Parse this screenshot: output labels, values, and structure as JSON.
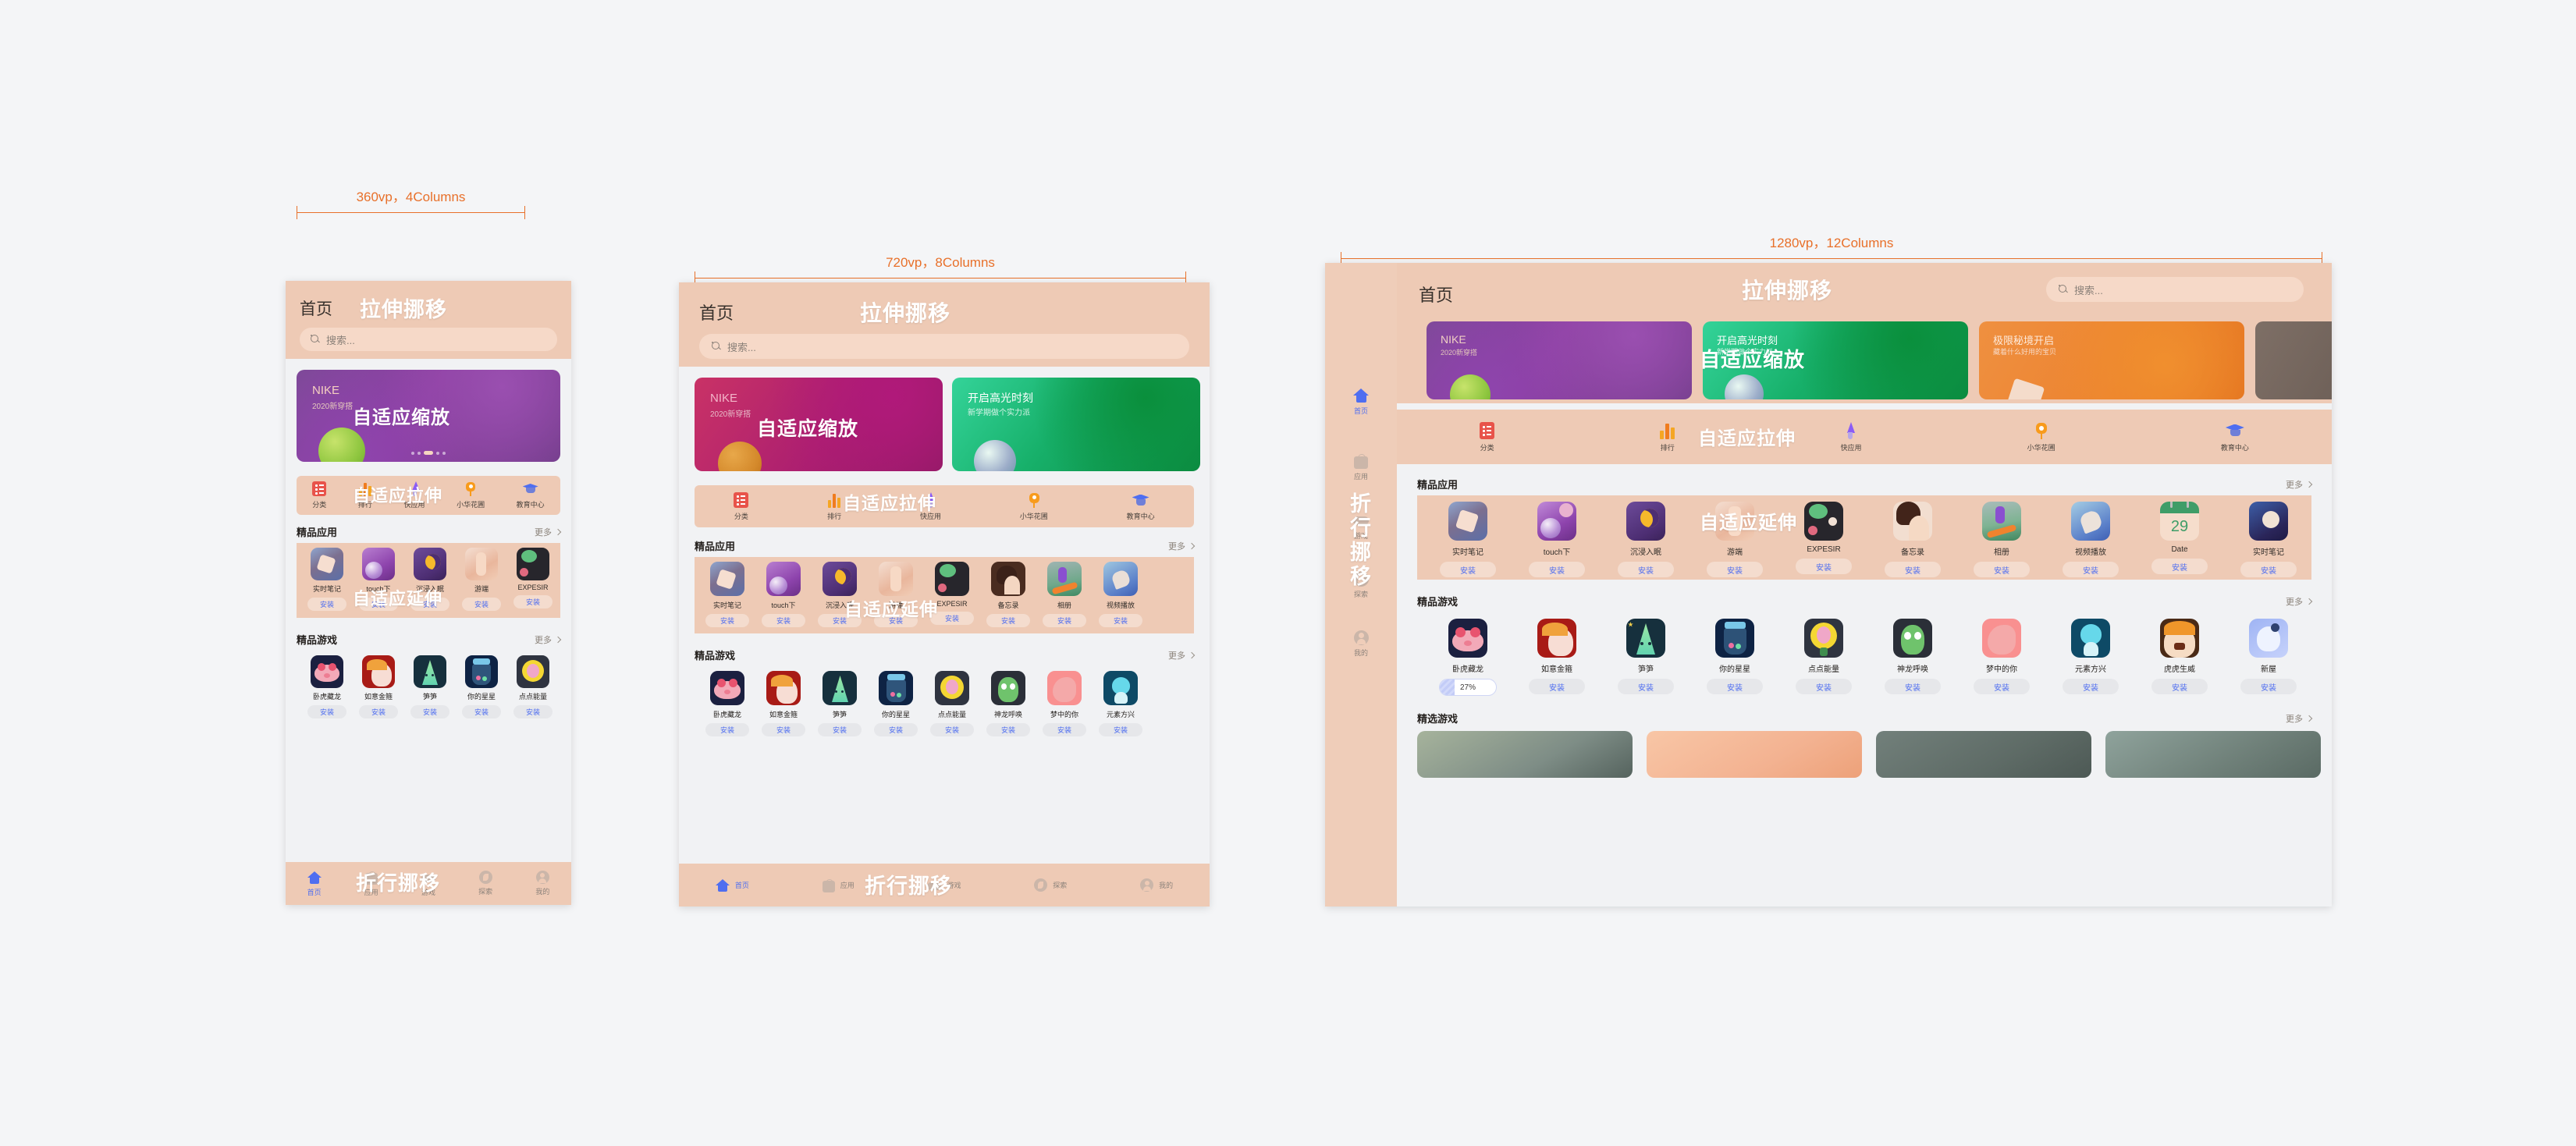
{
  "rulers": [
    {
      "label": "360vp，4Columns"
    },
    {
      "label": "720vp，8Columns"
    },
    {
      "label": "1280vp，12Columns"
    }
  ],
  "overlays": {
    "header": "拉伸挪移",
    "banner": "自适应缩放",
    "quickrow": "自适应拉伸",
    "approw": "自适应延伸",
    "tabbar": "折行挪移"
  },
  "app": {
    "header_title": "首页",
    "search_placeholder": "搜索...",
    "banners": [
      {
        "title": "NIKE",
        "subtitle": "2020新穿搭",
        "theme": "purple"
      },
      {
        "title": "开启高光时刻",
        "subtitle": "新学期做个实力派",
        "theme": "green"
      },
      {
        "title": "极限秘境开启",
        "subtitle": "藏着什么好用的宝贝",
        "theme": "orange"
      },
      {
        "title": "",
        "subtitle": "",
        "theme": "grey"
      }
    ],
    "banners_small": [
      {
        "title": "NIKE",
        "subtitle": "2020新穿搭",
        "theme": "magenta"
      },
      {
        "title": "开启高光时刻",
        "subtitle": "新学期做个实力派",
        "theme": "green"
      },
      {
        "title": "",
        "subtitle": "",
        "theme": "orange"
      }
    ],
    "quick_links": [
      {
        "label": "分类",
        "icon": "list-card-icon"
      },
      {
        "label": "排行",
        "icon": "bar-chart-icon"
      },
      {
        "label": "快应用",
        "icon": "rocket-icon"
      },
      {
        "label": "小华花圃",
        "icon": "flower-icon"
      },
      {
        "label": "教育中心",
        "icon": "graduation-cap-icon"
      }
    ],
    "sections": {
      "apps_title": "精品应用",
      "games_title": "精品游戏",
      "featured_games_title": "精选游戏",
      "more_label": "更多"
    },
    "install_label": "安装",
    "apps": [
      {
        "name": "实时笔记",
        "action": "安装"
      },
      {
        "name": "touch下",
        "action": "安装"
      },
      {
        "name": "沉浸入眠",
        "action": "安装"
      },
      {
        "name": "游端",
        "action": "安装"
      },
      {
        "name": "EXPESIR",
        "action": "安装"
      },
      {
        "name": "备忘录",
        "action": "安装"
      },
      {
        "name": "相册",
        "action": "安装"
      },
      {
        "name": "视频播放",
        "action": "安装"
      },
      {
        "name": "Date",
        "action": "安装"
      },
      {
        "name": "实时笔记",
        "action": "安装"
      }
    ],
    "games": [
      {
        "name": "卧虎藏龙",
        "action": "27%",
        "progress": 27
      },
      {
        "name": "如意金箍",
        "action": "安装"
      },
      {
        "name": "笋笋",
        "action": "安装"
      },
      {
        "name": "你的星星",
        "action": "安装"
      },
      {
        "name": "点点能量",
        "action": "安装"
      },
      {
        "name": "神龙呼唤",
        "action": "安装"
      },
      {
        "name": "梦中的你",
        "action": "安装"
      },
      {
        "name": "元素方兴",
        "action": "安装"
      },
      {
        "name": "虎虎生威",
        "action": "安装"
      },
      {
        "name": "新屋",
        "action": "安装"
      }
    ],
    "tabs": [
      {
        "label": "首页",
        "icon": "home-icon",
        "active": true
      },
      {
        "label": "应用",
        "icon": "bag-icon",
        "active": false
      },
      {
        "label": "游戏",
        "icon": "gamepad-icon",
        "active": false
      },
      {
        "label": "探索",
        "icon": "compass-icon",
        "active": false
      },
      {
        "label": "我的",
        "icon": "person-icon",
        "active": false
      }
    ]
  },
  "colors": {
    "accent": "#e8702a",
    "header_bg": "#eecab5",
    "page_bg": "#f1f2f4",
    "install_text": "#4f6ef0",
    "canvas": "#f4f5f7"
  }
}
